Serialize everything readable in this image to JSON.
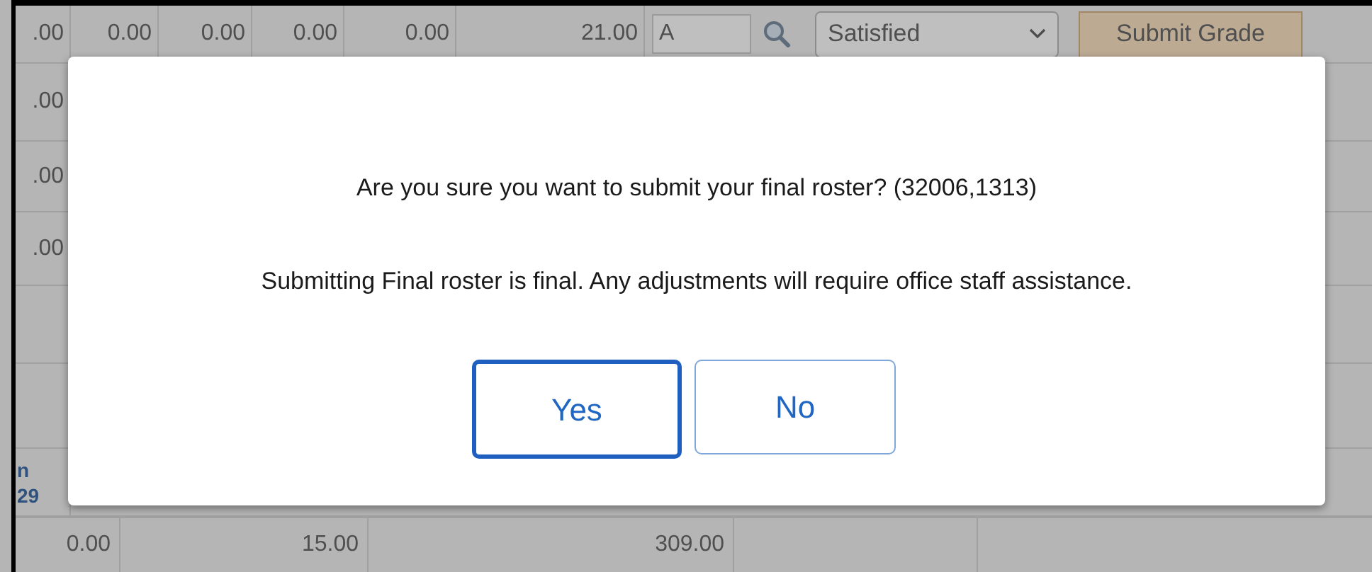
{
  "grade_row": {
    "cells": [
      ".00",
      "0.00",
      "0.00",
      "0.00",
      "0.00",
      "21.00"
    ],
    "grade_input": {
      "value": "A"
    },
    "status_select": {
      "value": "Satisfied"
    },
    "submit_button": {
      "label": "Submit Grade"
    }
  },
  "side_cells": [
    ".00",
    ".00",
    ".00"
  ],
  "name_link": {
    "lines": [
      "n",
      "29"
    ]
  },
  "totals_row": {
    "cells": [
      "0.00",
      "15.00",
      "309.00"
    ]
  },
  "dialog": {
    "message": "Are you sure you want to submit your final roster? (32006,1313)",
    "note": "Submitting Final roster is final. Any adjustments will require office staff assistance.",
    "buttons": [
      {
        "label": "Yes",
        "focused": true
      },
      {
        "label": "No",
        "focused": false
      }
    ]
  }
}
